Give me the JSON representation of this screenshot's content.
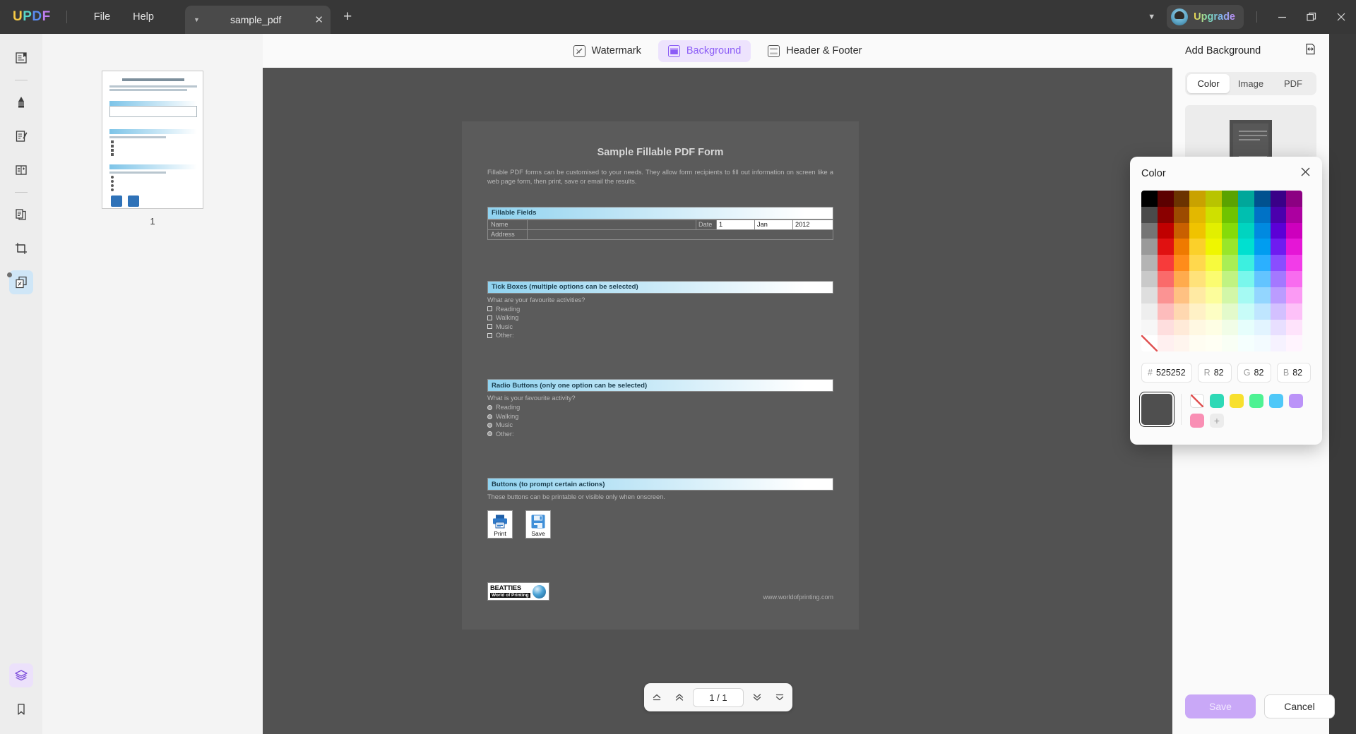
{
  "titlebar": {
    "logo": [
      "U",
      "P",
      "D",
      "F"
    ],
    "menus": [
      "File",
      "Help"
    ],
    "tab": {
      "title": "sample_pdf",
      "caret": "chevron-down-icon",
      "close": "✕"
    },
    "new_tab": "+",
    "chevron": "⌄",
    "upgrade_label": "Upgrade",
    "window_controls": [
      "minimize",
      "maximize",
      "close"
    ]
  },
  "rail": {
    "items": [
      {
        "name": "reader-mode",
        "icon": "book-open-icon"
      },
      {
        "name": "annotate",
        "icon": "highlighter-pen-icon"
      },
      {
        "name": "edit-pdf",
        "icon": "edit-document-icon"
      },
      {
        "name": "organize-pages",
        "icon": "page-list-icon"
      },
      {
        "name": "convert-pdf",
        "icon": "copy-document-icon"
      },
      {
        "name": "crop-page",
        "icon": "crop-icon"
      },
      {
        "name": "batch-background",
        "icon": "watermark-pages-icon"
      },
      {
        "name": "layers",
        "icon": "layers-icon"
      },
      {
        "name": "bookmark",
        "icon": "bookmark-icon"
      }
    ]
  },
  "thumbnails": {
    "page_label": "1"
  },
  "subbar": {
    "tabs": [
      {
        "label": "Watermark",
        "icon": "watermark-icon",
        "active": false
      },
      {
        "label": "Background",
        "icon": "background-icon",
        "active": true
      },
      {
        "label": "Header & Footer",
        "icon": "header-footer-icon",
        "active": false
      }
    ]
  },
  "document": {
    "title": "Sample Fillable PDF Form",
    "intro": "Fillable PDF forms can be customised to your needs. They allow form recipients to fill out information on screen like a web page form, then print, save or email the results.",
    "sections": [
      {
        "heading": "Fillable Fields",
        "rows": [
          {
            "label": "Name",
            "date_label": "Date",
            "date_day": "1",
            "date_month": "Jan",
            "date_year": "2012"
          },
          {
            "label": "Address"
          }
        ]
      },
      {
        "heading": "Tick Boxes (multiple options can be selected)",
        "question": "What are your favourite activities?",
        "options": [
          "Reading",
          "Walking",
          "Music",
          "Other:"
        ],
        "control": "checkbox"
      },
      {
        "heading": "Radio Buttons (only one option can be selected)",
        "question": "What is your favourite activity?",
        "options": [
          "Reading",
          "Walking",
          "Music",
          "Other:"
        ],
        "control": "radio"
      },
      {
        "heading": "Buttons (to prompt certain actions)",
        "question": "These buttons can be printable or visible only when onscreen.",
        "buttons": [
          {
            "label": "Print",
            "icon": "printer-icon"
          },
          {
            "label": "Save",
            "icon": "floppy-disk-icon"
          }
        ]
      }
    ],
    "footer": {
      "logo_line1": "BEATTIES",
      "logo_line2": "World of Printing",
      "url": "www.worldofprinting.com"
    }
  },
  "pagenav": {
    "first": "first-page",
    "prev": "previous-page",
    "value": "1 / 1",
    "next": "next-page",
    "last": "last-page"
  },
  "right_panel": {
    "title": "Add Background",
    "collapse_icon": "collapse-panel-icon",
    "tabs": [
      {
        "label": "Color",
        "active": true
      },
      {
        "label": "Image",
        "active": false
      },
      {
        "label": "PDF",
        "active": false
      }
    ],
    "color_chip": "#4f4f4f",
    "plus_label": "+",
    "save_label": "Save",
    "cancel_label": "Cancel"
  },
  "color_popup": {
    "title": "Color",
    "close_icon": "close-icon",
    "hex_key": "#",
    "hex_value": "525252",
    "channels": [
      {
        "key": "R",
        "value": "82"
      },
      {
        "key": "G",
        "value": "82"
      },
      {
        "key": "B",
        "value": "82"
      }
    ],
    "current_color": "#4f4f4f",
    "grid_columns": [
      [
        "#000000",
        "#4a4a4a",
        "#757575",
        "#9a9a9a",
        "#b4b4b4",
        "#c9c9c9",
        "#dedede",
        "#eeeeee",
        "#f7f7f7",
        "#ffffff"
      ],
      [
        "#5c0000",
        "#8a0000",
        "#c00000",
        "#e01111",
        "#f73b3b",
        "#fa6a6a",
        "#fb9393",
        "#fdbcbc",
        "#fedede",
        "#fff0f0"
      ],
      [
        "#6b3300",
        "#9c4b00",
        "#c96000",
        "#ef7a00",
        "#ff8c1a",
        "#ffab4d",
        "#ffc182",
        "#ffd8b0",
        "#ffead8",
        "#fff5ee"
      ],
      [
        "#c9a200",
        "#e3b800",
        "#f0c300",
        "#fbd02a",
        "#ffd84d",
        "#ffe27a",
        "#ffeaa3",
        "#fff1c6",
        "#fff8e2",
        "#fffdf2"
      ],
      [
        "#b8c400",
        "#cfe000",
        "#e2ef00",
        "#eff600",
        "#f7fa3d",
        "#fbfc70",
        "#fcfd9b",
        "#fdfec4",
        "#fefee4",
        "#ffffF4"
      ],
      [
        "#5aa300",
        "#6fc300",
        "#85db0a",
        "#99e62a",
        "#a9ee55",
        "#c0f382",
        "#d2f7a8",
        "#e3facb",
        "#f1fde7",
        "#f9fff5"
      ],
      [
        "#00a79a",
        "#00bfb0",
        "#00d4c0",
        "#00e0d0",
        "#3cf0e0",
        "#79f7ec",
        "#a5faf3",
        "#c8fcf8",
        "#e6fefc",
        "#f5fffe"
      ],
      [
        "#00518f",
        "#0072c6",
        "#008ae0",
        "#009df0",
        "#2bb0ff",
        "#63c4ff",
        "#93d6ff",
        "#bfe6ff",
        "#e2f4ff",
        "#f3fbff"
      ],
      [
        "#3a0088",
        "#4b00ad",
        "#5c00d6",
        "#6f1cf0",
        "#8a4dff",
        "#a478ff",
        "#bb9cff",
        "#d3c0ff",
        "#e8dfff",
        "#f6f2ff"
      ],
      [
        "#8c0082",
        "#ac00a0",
        "#cd00bd",
        "#e516d6",
        "#f23ce8",
        "#f86cef",
        "#fb9af4",
        "#fdc1f8",
        "#fee3fb",
        "#fff4fe"
      ]
    ],
    "recent_colors": [
      "none",
      "#2ed9b6",
      "#f8e02e",
      "#4ef293",
      "#4fc8f8",
      "#bb93f8",
      "#f98fb4"
    ],
    "add_label": "+"
  }
}
